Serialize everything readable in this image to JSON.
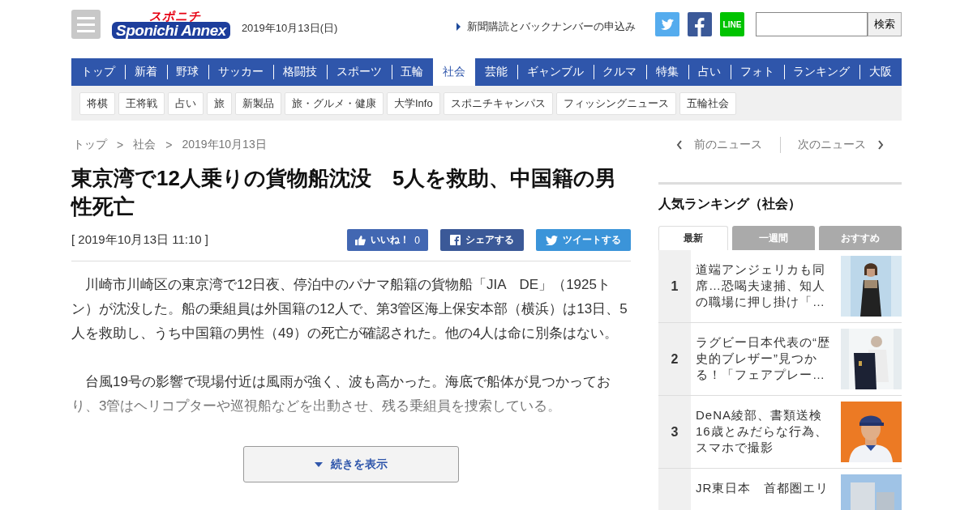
{
  "header": {
    "logo_top": "スポニチ",
    "logo_main": "Sponichi Annex",
    "date": "2019年10月13日(日)",
    "subscribe_link": "新聞購読とバックナンバーの申込み",
    "line_label": "LINE",
    "search_button": "検索"
  },
  "nav": [
    {
      "label": "トップ",
      "selected": false
    },
    {
      "label": "新着",
      "selected": false
    },
    {
      "label": "野球",
      "selected": false
    },
    {
      "label": "サッカー",
      "selected": false
    },
    {
      "label": "格闘技",
      "selected": false
    },
    {
      "label": "スポーツ",
      "selected": false
    },
    {
      "label": "五輪",
      "selected": false
    },
    {
      "label": "社会",
      "selected": true
    },
    {
      "label": "芸能",
      "selected": false
    },
    {
      "label": "ギャンブル",
      "selected": false
    },
    {
      "label": "クルマ",
      "selected": false
    },
    {
      "label": "特集",
      "selected": false
    },
    {
      "label": "占い",
      "selected": false
    },
    {
      "label": "フォト",
      "selected": false
    },
    {
      "label": "ランキング",
      "selected": false
    },
    {
      "label": "大阪",
      "selected": false
    }
  ],
  "subnav": [
    "将棋",
    "王将戦",
    "占い",
    "旅",
    "新製品",
    "旅・グルメ・健康",
    "大学Info",
    "スポニチキャンパス",
    "フィッシングニュース",
    "五輪社会"
  ],
  "breadcrumb": [
    "トップ",
    "社会",
    "2019年10月13日"
  ],
  "breadcrumb_separator": ">",
  "article": {
    "title": "東京湾で12人乗りの貨物船沈没　5人を救助、中国籍の男性死亡",
    "timestamp": "[ 2019年10月13日 11:10 ]",
    "share": [
      {
        "kind": "like",
        "label": "いいね！",
        "count": "0"
      },
      {
        "kind": "facebook",
        "label": "シェアする"
      },
      {
        "kind": "twitter",
        "label": "ツイートする"
      }
    ],
    "paragraphs": [
      "　川崎市川崎区の東京湾で12日夜、停泊中のパナマ船籍の貨物船「JIA　DE」（1925トン）が沈没した。船の乗組員は外国籍の12人で、第3管区海上保安本部（横浜）は13日、5人を救助し、うち中国籍の男性（49）の死亡が確認された。他の4人は命に別条はない。",
      "　台風19号の影響で現場付近は風雨が強く、波も高かった。海底で船体が見つかっており、3管はヘリコプターや巡視船などを出動させ、残る乗組員を捜索している。"
    ],
    "more_button": "続きを表示"
  },
  "pager": {
    "prev": "前のニュース",
    "next": "次のニュース"
  },
  "ranking": {
    "title": "人気ランキング（社会）",
    "tabs": [
      {
        "label": "最新",
        "selected": true
      },
      {
        "label": "一週間",
        "selected": false
      },
      {
        "label": "おすすめ",
        "selected": false
      }
    ],
    "items": [
      {
        "rank": "1",
        "title": "道端アンジェリカも同席…恐喝夫逮捕、知人の職場に押し掛け「…"
      },
      {
        "rank": "2",
        "title": "ラグビー日本代表の“歴史的ブレザー”見つかる！「フェアプレー…"
      },
      {
        "rank": "3",
        "title": "DeNA綾部、書類送検　16歳とみだらな行為、スマホで撮影"
      },
      {
        "title": "JR東日本　首都圏エリ"
      }
    ]
  }
}
